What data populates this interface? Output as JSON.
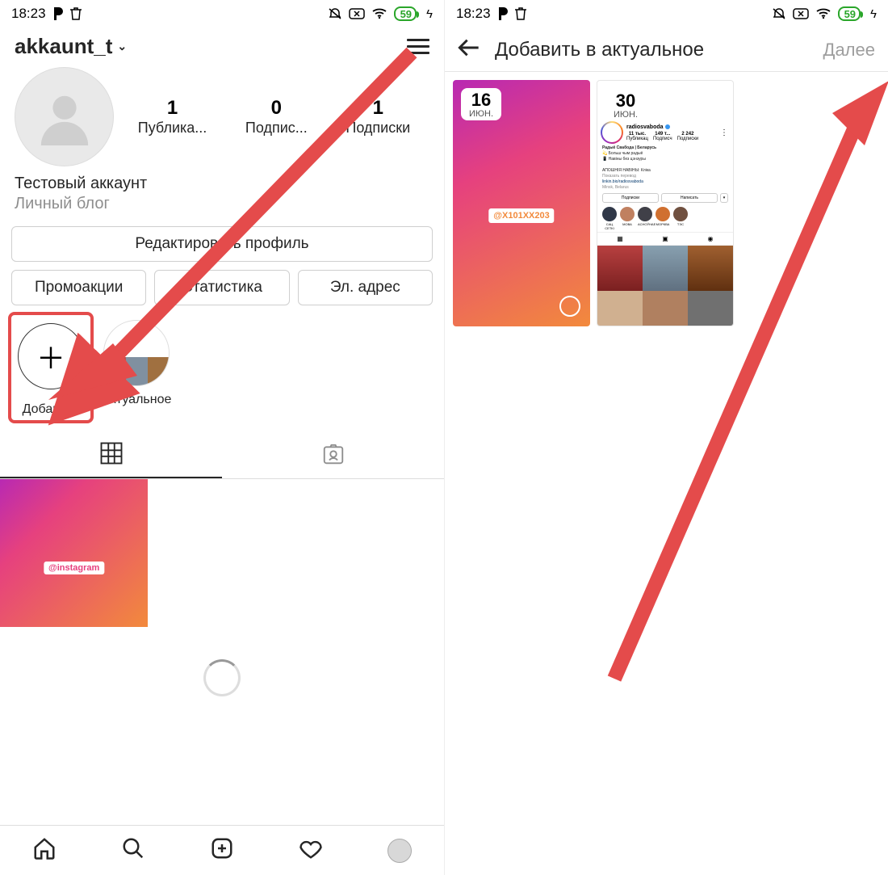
{
  "status": {
    "time": "18:23",
    "battery": "59"
  },
  "left": {
    "username": "akkaunt_t",
    "stats": {
      "posts": "1",
      "followers": "0",
      "following": "1",
      "posts_lbl": "Публика...",
      "followers_lbl": "Подпис...",
      "following_lbl": "Подписки"
    },
    "bio": {
      "name": "Тестовый аккаунт",
      "category": "Личный блог"
    },
    "edit_btn": "Редактировать профиль",
    "btn1": "Промоакции",
    "btn2": "Статистика",
    "btn3": "Эл. адрес",
    "hl_add": "Добавить",
    "hl_actual": "Актуальное",
    "post_tag": "@instagram"
  },
  "right": {
    "title": "Добавить в актуальное",
    "next": "Далее",
    "story1": {
      "day": "16",
      "mon": "ИЮН.",
      "mention": "@X101XX203"
    },
    "story2": {
      "day": "30",
      "mon": "ИЮН.",
      "name": "radiosvaboda",
      "s1": "11 тыс.",
      "s1l": "Публикац",
      "s2": "149 т...",
      "s2l": "Подписч",
      "s3": "2 242",
      "s3l": "Подписки",
      "bio_name": "Радыё Свабода | Беларусь",
      "bio_l1": "💫 Больш чым радыё",
      "bio_l2": "📱 Навіны без цэнзуры",
      "bio_l3": "АПОШНІЯ НАВІНЫ: Клікa",
      "bio_l4": "Показать перевод",
      "bio_link": "linkin.bio/radiosvaboda",
      "bio_loc": "Minsk, Belarus",
      "b_follow": "Подписки",
      "b_msg": "Написать",
      "h1": "САЦ СЕТКІ",
      "h2": "МОВА",
      "h3": "АСНОЎНАЕ",
      "h4": "МОРКВА",
      "h5": "ТЭС"
    }
  }
}
